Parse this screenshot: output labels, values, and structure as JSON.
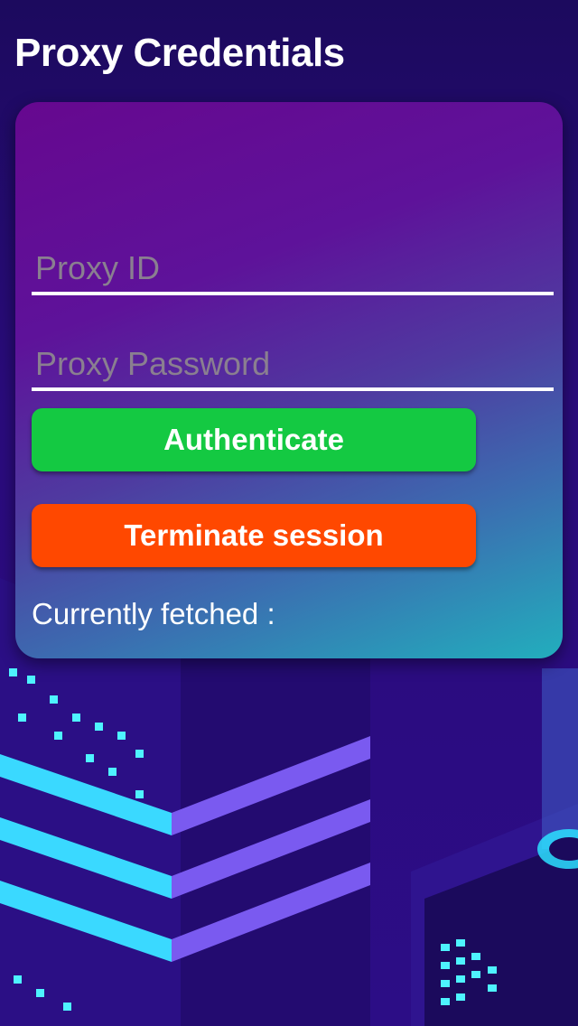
{
  "header": {
    "title": "Proxy Credentials"
  },
  "form": {
    "proxy_id": {
      "value": "",
      "placeholder": "Proxy ID"
    },
    "proxy_password": {
      "value": "",
      "placeholder": "Proxy Password"
    },
    "authenticate_label": "Authenticate",
    "terminate_label": "Terminate session",
    "status_label": "Currently fetched :"
  },
  "colors": {
    "authenticate_button": "#14c942",
    "terminate_button": "#ff4800",
    "card_gradient_start": "#66088f",
    "card_gradient_end": "#22aebd",
    "background": "#2a0b7c"
  }
}
